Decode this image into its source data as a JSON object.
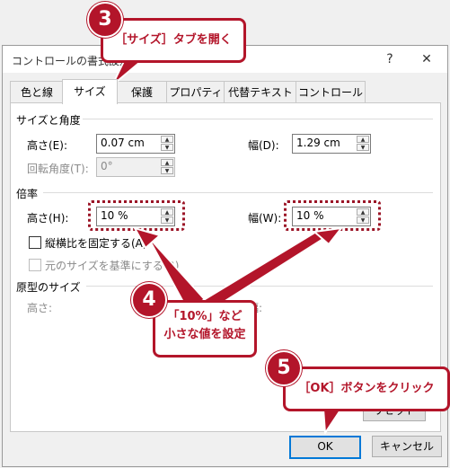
{
  "dialog": {
    "title": "コントロールの書式設定",
    "help_glyph": "?",
    "close_glyph": "✕"
  },
  "tabs": [
    {
      "label": "色と線",
      "active": false
    },
    {
      "label": "サイズ",
      "active": true
    },
    {
      "label": "保護",
      "active": false
    },
    {
      "label": "プロパティ",
      "active": false
    },
    {
      "label": "代替テキスト",
      "active": false
    },
    {
      "label": "コントロール",
      "active": false
    }
  ],
  "size_section": {
    "heading": "サイズと角度",
    "height_label": "高さ(E):",
    "height_value": "0.07 cm",
    "width_label": "幅(D):",
    "width_value": "1.29 cm",
    "rotation_label": "回転角度(T):",
    "rotation_value": "0°"
  },
  "scale_section": {
    "heading": "倍率",
    "height_label": "高さ(H):",
    "height_value": "10 %",
    "width_label": "幅(W):",
    "width_value": "10 %",
    "lock_aspect_label": "縦横比を固定する(A)",
    "relative_original_label": "元のサイズを基準にする(R)"
  },
  "original_section": {
    "heading": "原型のサイズ",
    "height_label": "高さ:",
    "width_label": "幅:"
  },
  "buttons": {
    "ok": "OK",
    "cancel": "キャンセル",
    "reset": "リセット"
  },
  "annotations": {
    "step3_number": "3",
    "step3_text": "［サイズ］タブを開く",
    "step4_number": "4",
    "step4_line1": "「10%」など",
    "step4_line2": "小さな値を設定",
    "step5_number": "5",
    "step5_text": "［OK］ボタンをクリック"
  },
  "colors": {
    "annotation_red": "#b3152a",
    "default_button_blue": "#0078d7"
  }
}
